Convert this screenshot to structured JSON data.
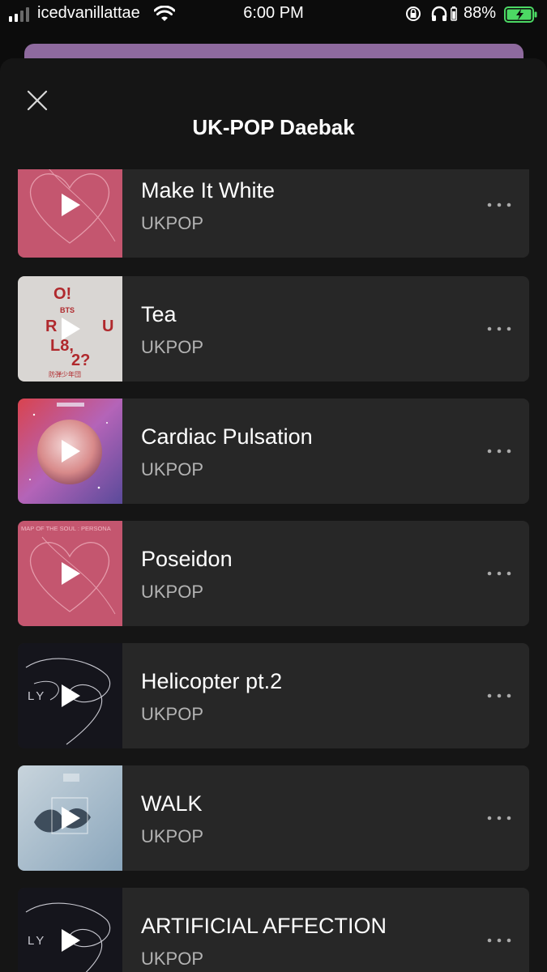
{
  "status_bar": {
    "carrier": "icedvanillattae",
    "time": "6:00 PM",
    "battery_percent": "88%",
    "icons": [
      "signal-icon",
      "wifi-icon",
      "orientation-lock-icon",
      "headphones-icon",
      "battery-icon"
    ]
  },
  "sheet": {
    "title": "UK-POP Daebak",
    "close_icon": "close-icon"
  },
  "tracks": [
    {
      "title": "Make It White",
      "artist": "UKPOP",
      "art_style": "pink-persona"
    },
    {
      "title": "Tea",
      "artist": "UKPOP",
      "art_style": "grey-oul82",
      "art_text": {
        "line1": "O!",
        "line2": "R",
        "line3": "U",
        "line4": "L8,",
        "line5": "2?",
        "badge": "BTS",
        "footer": "防弾少年団"
      }
    },
    {
      "title": "Cardiac Pulsation",
      "artist": "UKPOP",
      "art_style": "galaxy-planet"
    },
    {
      "title": "Poseidon",
      "artist": "UKPOP",
      "art_style": "pink-persona",
      "art_text": {
        "caption": "MAP OF THE SOUL : PERSONA"
      }
    },
    {
      "title": "Helicopter pt.2",
      "artist": "UKPOP",
      "art_style": "dark-ly",
      "art_text": {
        "caption": "LY"
      }
    },
    {
      "title": "WALK",
      "artist": "UKPOP",
      "art_style": "blue-butterfly"
    },
    {
      "title": "ARTIFICIAL AFFECTION",
      "artist": "UKPOP",
      "art_style": "dark-ly",
      "art_text": {
        "caption": "LY"
      }
    }
  ],
  "colors": {
    "sheet_bg": "#151515",
    "card_bg": "#272727",
    "artist_text": "#b3b3b3",
    "banner": "#8e6a9e",
    "battery_green": "#4cd964"
  }
}
